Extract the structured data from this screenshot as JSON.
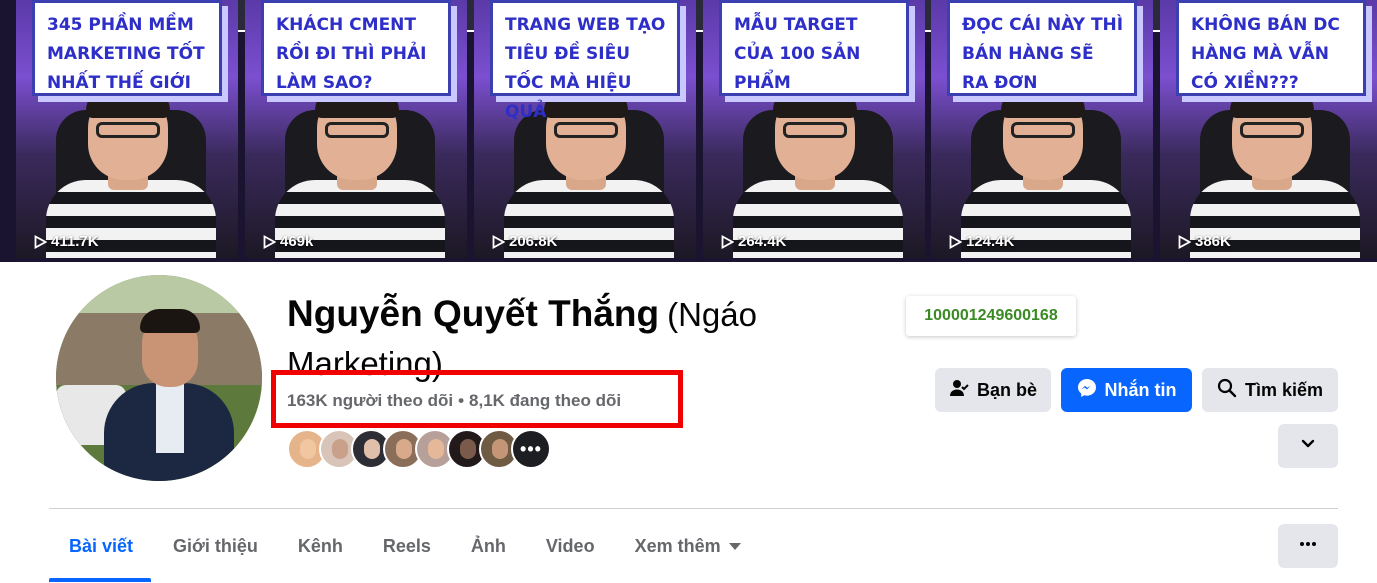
{
  "cover": {
    "tiles": [
      {
        "caption": "345 PHẦN MỀM MARKETING TỐT NHẤT THẾ GIỚI",
        "views": "411.7K"
      },
      {
        "caption": "KHÁCH CMENT RỒI ĐI THÌ PHẢI LÀM SAO?",
        "views": "469k"
      },
      {
        "caption": "TRANG WEB TẠO TIÊU ĐỀ SIÊU TỐC MÀ HIỆU QUẢ",
        "views": "206.8K"
      },
      {
        "caption": "MẪU TARGET CỦA 100 SẢN PHẨM",
        "views": "264.4K"
      },
      {
        "caption": "ĐỌC CÁI NÀY THÌ BÁN HÀNG SẼ RA ĐƠN",
        "views": "124.4K"
      },
      {
        "caption": "KHÔNG BÁN DC HÀNG MÀ VẪN CÓ XIỀN???",
        "views": "386K"
      }
    ]
  },
  "profile": {
    "name": "Nguyễn Quyết Thắng",
    "alternate_name": "(Ngáo Marketing)",
    "user_id": "100001249600168",
    "followers": "163K người theo dõi",
    "following": "8,1K đang theo dõi",
    "separator": "•",
    "friends_more": "•••"
  },
  "actions": {
    "friends_label": "Bạn bè",
    "message_label": "Nhắn tin",
    "search_label": "Tìm kiếm"
  },
  "tabs": [
    {
      "label": "Bài viết"
    },
    {
      "label": "Giới thiệu"
    },
    {
      "label": "Kênh"
    },
    {
      "label": "Reels"
    },
    {
      "label": "Ảnh"
    },
    {
      "label": "Video"
    },
    {
      "label": "Xem thêm"
    }
  ],
  "colors": {
    "accent": "#0866ff",
    "highlight": "#f00000",
    "uid_text": "#3a8a23",
    "secondary_text": "#65676b"
  }
}
